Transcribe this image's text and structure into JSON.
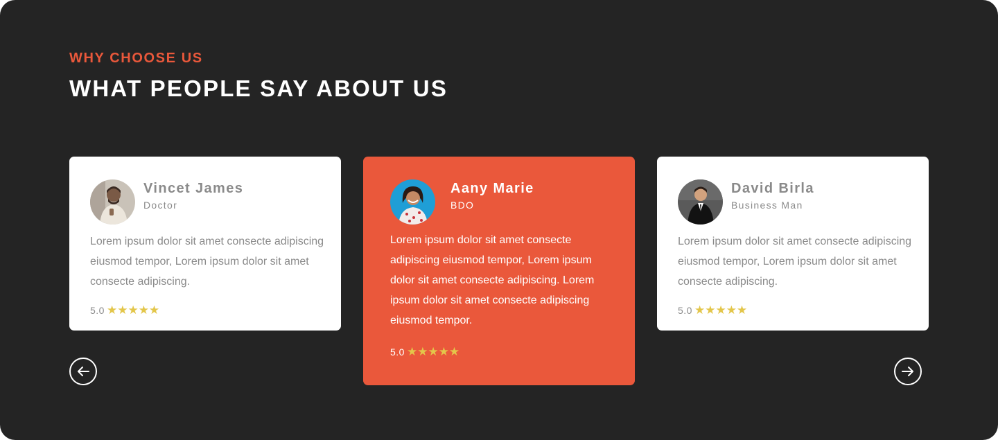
{
  "section": {
    "eyebrow": "WHY CHOOSE US",
    "heading": "WHAT PEOPLE SAY ABOUT US"
  },
  "colors": {
    "background": "#242424",
    "accent": "#ea583b",
    "card": "#ffffff",
    "star": "#e3c64a",
    "muted_text": "#8a8a8a"
  },
  "testimonials": [
    {
      "name": "Vincet James",
      "role": "Doctor",
      "quote": "Lorem ipsum dolor sit amet consecte adipiscing eiusmod tempor, Lorem ipsum dolor sit amet consecte adipiscing.",
      "rating_text": "5.0",
      "stars": "★★★★★",
      "avatar_icon": "man-avatar-photo",
      "highlighted": false
    },
    {
      "name": "Aany Marie",
      "role": "BDO",
      "quote": "Lorem ipsum dolor sit amet consecte adipiscing eiusmod tempor, Lorem ipsum dolor sit amet consecte adipiscing. Lorem ipsum dolor sit amet consecte adipiscing eiusmod tempor.",
      "rating_text": "5.0",
      "stars": "★★★★★",
      "avatar_icon": "woman-avatar-photo",
      "highlighted": true
    },
    {
      "name": "David Birla",
      "role": "Business Man",
      "quote": "Lorem ipsum dolor sit amet consecte adipiscing eiusmod tempor, Lorem ipsum dolor sit amet consecte adipiscing.",
      "rating_text": "5.0",
      "stars": "★★★★★",
      "avatar_icon": "man-suit-avatar-photo",
      "highlighted": false
    }
  ],
  "navigation": {
    "prev_icon": "arrow-left-circle-icon",
    "next_icon": "arrow-right-circle-icon"
  }
}
